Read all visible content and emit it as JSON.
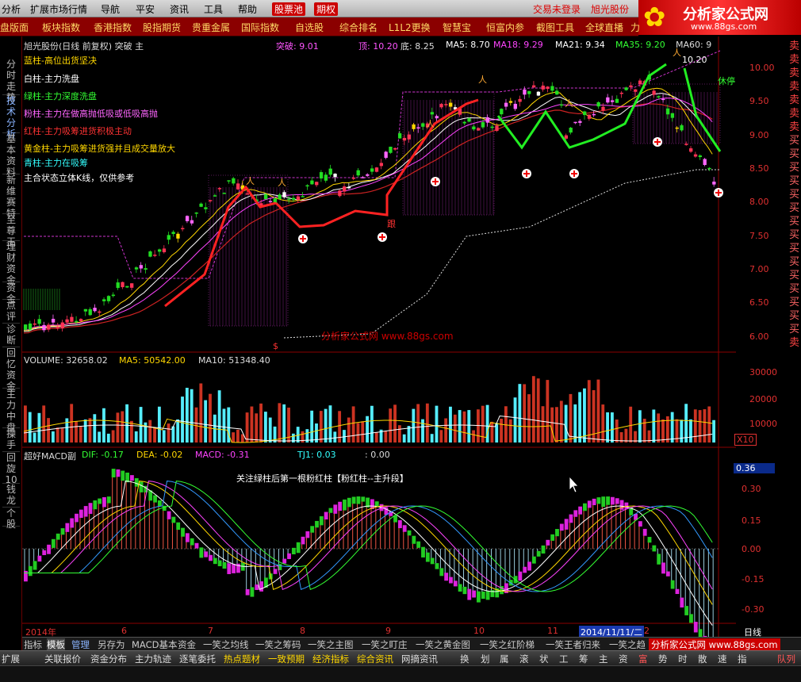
{
  "menu": {
    "items": [
      "分析",
      "扩展市场行情",
      "导航",
      "平安",
      "资讯",
      "工具",
      "帮助"
    ],
    "tabs": [
      "股票池",
      "期权"
    ],
    "login": "交易未登录",
    "stock": "旭光股份"
  },
  "logo": {
    "title": "分析家公式网",
    "url": "www.88gs.com"
  },
  "quickbar": [
    "盘版面",
    "板块指数",
    "香港指数",
    "股指期货",
    "贵重金属",
    "国际指数",
    "自选股",
    "综合排名",
    "L1L2更换",
    "智慧宝",
    "恒富内参",
    "截图工具",
    "全球直播",
    "力"
  ],
  "leftbar": [
    "分时走势",
    "技术分析",
    "基本资料",
    "新维赛特",
    "至尊王",
    "理财资金",
    "资金",
    "点评",
    "诊断",
    "回忆资金",
    "主力中盘",
    "操手",
    "回旋10",
    "钱龙",
    "个股"
  ],
  "rightbar": [
    "卖",
    "卖",
    "卖",
    "卖",
    "卖",
    "卖",
    "卖",
    "买",
    "买",
    "买",
    "买",
    "买",
    "买",
    "买",
    "买",
    "买",
    "买",
    "买",
    "买",
    "买",
    "买",
    "买",
    "卖"
  ],
  "main_header": {
    "title": "旭光股份(日线 前复权) 突破 主",
    "tupo": "突破: 9.01",
    "ding": "顶: 10.20",
    "di": "底: 8.25",
    "ma5": "MA5: 8.70",
    "ma18": "MA18: 9.29",
    "ma21": "MA21: 9.34",
    "ma35": "MA35: 9.20",
    "ma60": "MA60: 9"
  },
  "legend": [
    {
      "text": "蓝柱-高位出货坚决",
      "color": "#ffd700"
    },
    {
      "text": "白柱-主力洗盘",
      "color": "#ffffff"
    },
    {
      "text": "绿柱-主力深度洗盘",
      "color": "#33ff33"
    },
    {
      "text": "粉柱-主力在做高抛低吸或低吸高抛",
      "color": "#ff66ff"
    },
    {
      "text": "红柱-主力吸筹进货积极主动",
      "color": "#ff3333"
    },
    {
      "text": "黄金柱-主力吸筹进货强并且成交量放大",
      "color": "#ffd700"
    },
    {
      "text": "青柱-主力在吸筹",
      "color": "#33ffff"
    },
    {
      "text": "主合状态立体K线，仅供参考",
      "color": "#ffffff"
    }
  ],
  "price_annotations": {
    "peak": "10.20",
    "gen": "跟",
    "xiu": "休停"
  },
  "watermark": "分析家公式网 www.88gs.com",
  "y_main": [
    "10.00",
    "9.50",
    "9.00",
    "8.50",
    "8.00",
    "7.50",
    "7.00",
    "6.50",
    "6.00"
  ],
  "volume_header": {
    "vol": "VOLUME: 32658.02",
    "ma5": "MA5: 50542.00",
    "ma10": "MA10: 51348.40"
  },
  "y_vol": [
    "30000",
    "20000",
    "10000"
  ],
  "vol_unit": "X10",
  "macd_header": {
    "title": "超好MACD副",
    "dif": "DIF: -0.17",
    "dea": "DEA: -0.02",
    "macd": "MACD: -0.31",
    "tj1": "TJ1: 0.03",
    "zero": ": 0.00"
  },
  "macd_note": "关注绿柱后第一根粉红柱【粉红柱--主升段】",
  "macd_value_box": "0.36",
  "y_macd": [
    "0.30",
    "0.15",
    "0.00",
    "-0.15",
    "-0.30"
  ],
  "x_labels": [
    {
      "text": "2014年"
    },
    {
      "text": "6"
    },
    {
      "text": "7"
    },
    {
      "text": "8"
    },
    {
      "text": "9"
    },
    {
      "text": "10"
    },
    {
      "text": "11"
    },
    {
      "text": "2014/11/11/二"
    },
    {
      "text": "2"
    }
  ],
  "period": "日线",
  "bottom_tabs": [
    "指标",
    "模板",
    "管理",
    "另存为",
    "MACD基本",
    "资金",
    "一笑之均线",
    "一笑之筹码",
    "一笑之主图",
    "一笑之盯庄",
    "一笑之黄金图",
    "一笑之红阶梯",
    "一笑王者归来",
    "一笑之趋"
  ],
  "bottom_bar": [
    "扩展",
    "关联报价",
    "资金分布",
    "主力轨迹",
    "逐笔委托",
    "热点题材",
    "一致预期",
    "经济指标",
    "综合资讯",
    "网摘资讯",
    "换",
    "划",
    "属",
    "滚",
    "状",
    "工",
    "筹",
    "主",
    "资",
    "富",
    "势",
    "时",
    "散",
    "速",
    "指",
    "队列"
  ],
  "bottom_brand": "分析家公式网 www.88gs.com",
  "misc": {
    "side_dollar": "$"
  }
}
